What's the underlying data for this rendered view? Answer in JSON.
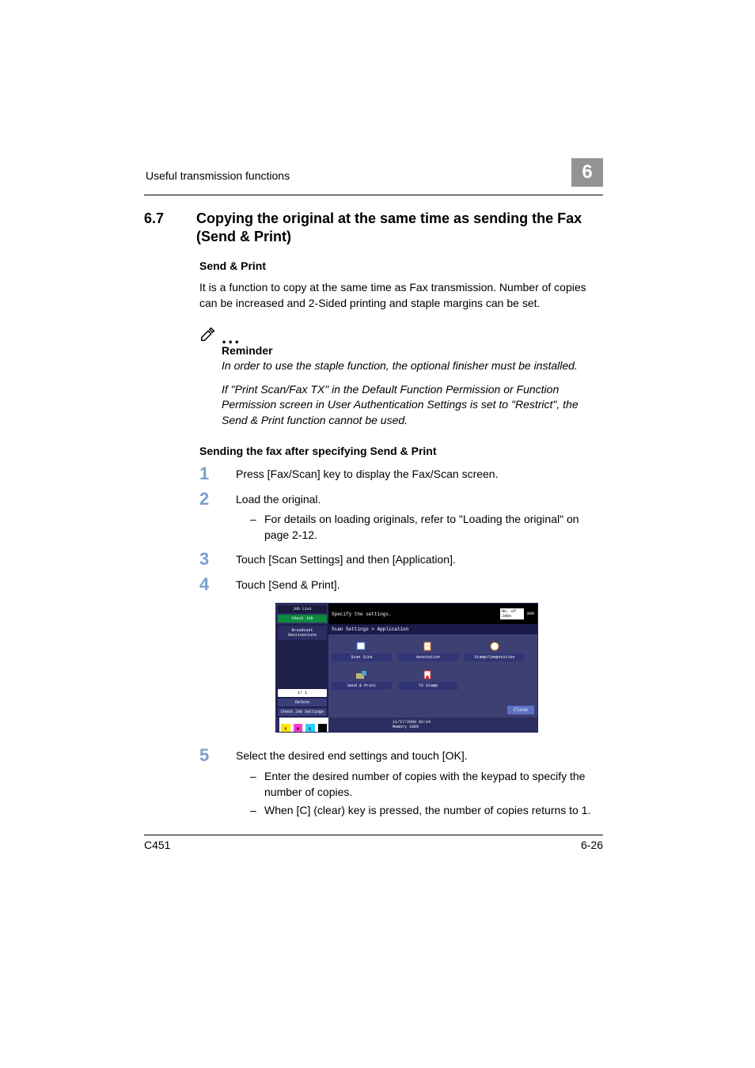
{
  "header": {
    "running_head": "Useful transmission functions",
    "chapter_number": "6"
  },
  "section": {
    "number": "6.7",
    "title": "Copying the original at the same time as sending the Fax (Send & Print)"
  },
  "sendprint_h": "Send & Print",
  "sendprint_p": "It is a function to copy at the same time as Fax transmission. Number of copies can be increased and 2-Sided printing and staple margins can be set.",
  "reminder_label": "Reminder",
  "reminder_p1": "In order to use the staple function, the optional finisher must be installed.",
  "reminder_p2": "If \"Print Scan/Fax TX\" in the Default Function Permission or Function Permission screen in User Authentication Settings is set to \"Restrict\", the Send & Print function cannot be used.",
  "steps_title": "Sending the fax after specifying Send & Print",
  "step1": "Press [Fax/Scan] key to display the Fax/Scan screen.",
  "step2": "Load the original.",
  "step2_sub1": "For details on loading originals, refer to \"Loading the original\" on page 2-12.",
  "step3": "Touch [Scan Settings] and then [Application].",
  "step4": "Touch [Send & Print].",
  "step5": "Select the desired end settings and touch [OK].",
  "step5_sub1": "Enter the desired number of copies with the keypad to specify the number of copies.",
  "step5_sub2": "When [C] (clear) key is pressed, the number of copies returns to 1.",
  "screenshot": {
    "job_list": "Job List",
    "check_job": "Check Job",
    "specify": "Specify the settings.",
    "status_label": "No. of Jobs",
    "counter": "000",
    "bcast": "Broadcast Destinations",
    "header_bar": "Scan Settings > Application",
    "tiles": {
      "scan_size": "Scan Size",
      "annotation": "Annotation",
      "stamp_comp": "Stamp/Composition",
      "send_print": "Send & Print",
      "tx_stamp": "TX Stamp"
    },
    "page_ind": "1/  1",
    "delete": "Delete",
    "check_settings": "Check Job Settings",
    "datetime": "11/17/2006   03:24",
    "memory": "Memory        100%",
    "close": "Close"
  },
  "footer": {
    "left": "C451",
    "right": "6-26"
  }
}
